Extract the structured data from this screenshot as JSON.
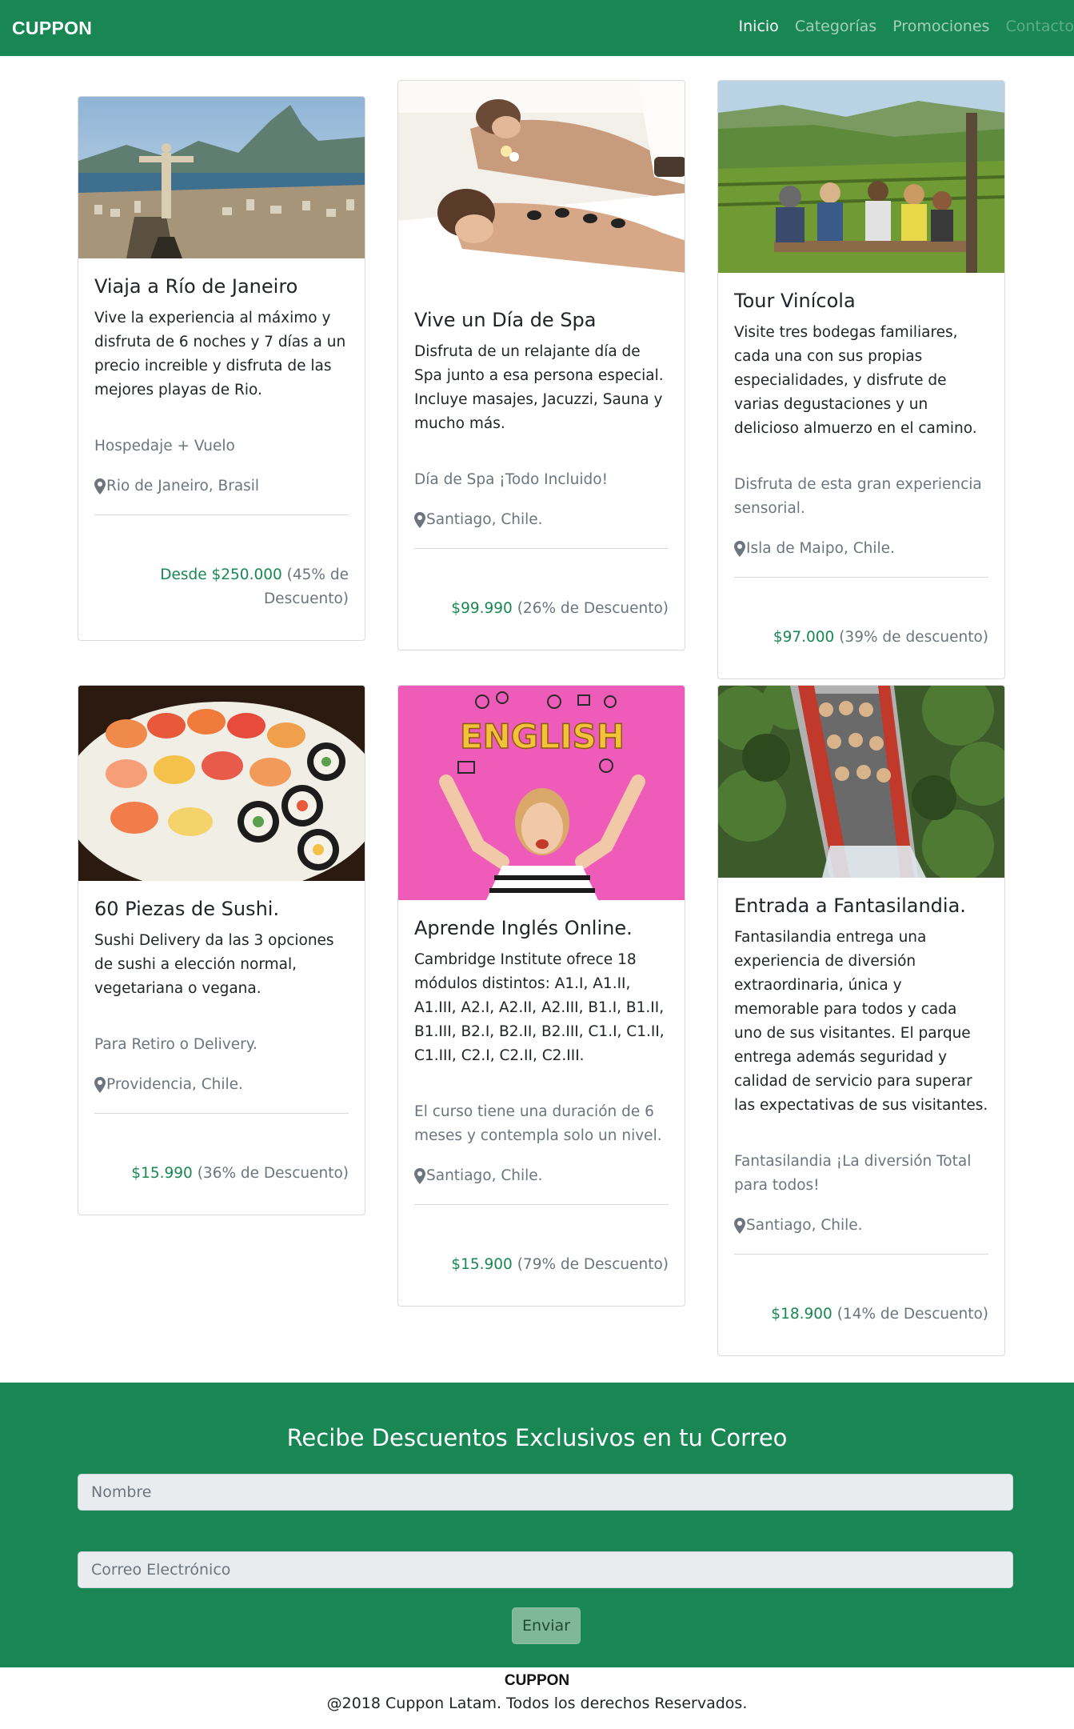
{
  "nav": {
    "brand": "CUPPON",
    "links": [
      "Inicio",
      "Categorías",
      "Promociones",
      "Contacto"
    ]
  },
  "cards": [
    {
      "title": "Viaja a Río de Janeiro",
      "text": "Vive la experiencia al máximo y disfruta de 6 noches y 7 días a un precio increible y disfruta de las mejores playas de Rio.",
      "subtitle": "Hospedaje + Vuelo",
      "location": "Rio de Janeiro, Brasil",
      "price": "Desde $250.000",
      "discount": "(45% de Descuento)"
    },
    {
      "title": "Vive un Día de Spa",
      "text": "Disfruta de un relajante día de Spa junto a esa persona especial. Incluye masajes, Jacuzzi, Sauna y mucho más.",
      "subtitle": "Día de Spa ¡Todo Incluido!",
      "location": "Santiago, Chile.",
      "price": "$99.990",
      "discount": "(26% de Descuento)"
    },
    {
      "title": "Tour Vinícola",
      "text": "Visite tres bodegas familiares, cada una con sus propias especialidades, y disfrute de varias degustaciones y un delicioso almuerzo en el camino.",
      "subtitle": "Disfruta de esta gran experiencia sensorial.",
      "location": "Isla de Maipo, Chile.",
      "price": "$97.000",
      "discount": "(39% de descuento)"
    },
    {
      "title": "60 Piezas de Sushi.",
      "text": "Sushi Delivery da las 3 opciones de sushi a elección normal, vegetariana o vegana.",
      "subtitle": "Para Retiro o Delivery.",
      "location": "Providencia, Chile.",
      "price": "$15.990",
      "discount": "(36% de Descuento)"
    },
    {
      "title": "Aprende Inglés Online.",
      "text": "Cambridge Institute ofrece 18 módulos distintos: A1.I, A1.II, A1.III, A2.I, A2.II, A2.III, B1.I, B1.II, B1.III, B2.I, B2.II, B2.III, C1.I, C1.II, C1.III, C2.I, C2.II, C2.III.",
      "subtitle": "El curso tiene una duración de 6 meses y contempla solo un nivel.",
      "location": "Santiago, Chile.",
      "price": "$15.900",
      "discount": "(79% de Descuento)",
      "image_text": "ENGLISH"
    },
    {
      "title": "Entrada a Fantasilandia.",
      "text": "Fantasilandia entrega una experiencia de diversión extraordinaria, única y memorable para todos y cada uno de sus visitantes. El parque entrega además seguridad y calidad de servicio para superar las expectativas de sus visitantes.",
      "subtitle": "Fantasilandia ¡La diversión Total para todos!",
      "location": "Santiago, Chile.",
      "price": "$18.900",
      "discount": "(14% de Descuento)"
    }
  ],
  "subscribe": {
    "title": "Recibe Descuentos Exclusivos en tu Correo",
    "name_placeholder": "Nombre",
    "email_placeholder": "Correo Electrónico",
    "button": "Enviar"
  },
  "footer": {
    "brand": "CUPPON",
    "copyright": "@2018 Cuppon Latam. Todos los derechos Reservados."
  },
  "colors": {
    "primary_green": "#198754",
    "muted_text": "#6c757d"
  }
}
